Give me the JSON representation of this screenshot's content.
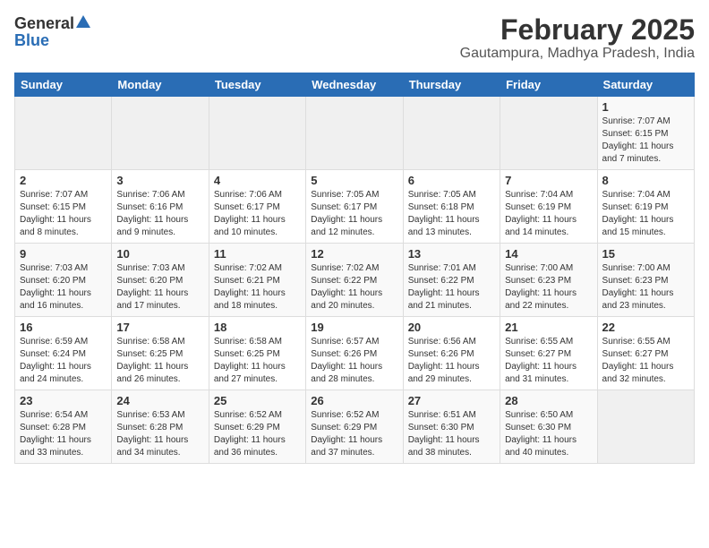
{
  "header": {
    "logo_general": "General",
    "logo_blue": "Blue",
    "title": "February 2025",
    "subtitle": "Gautampura, Madhya Pradesh, India"
  },
  "weekdays": [
    "Sunday",
    "Monday",
    "Tuesday",
    "Wednesday",
    "Thursday",
    "Friday",
    "Saturday"
  ],
  "weeks": [
    [
      {
        "day": "",
        "info": ""
      },
      {
        "day": "",
        "info": ""
      },
      {
        "day": "",
        "info": ""
      },
      {
        "day": "",
        "info": ""
      },
      {
        "day": "",
        "info": ""
      },
      {
        "day": "",
        "info": ""
      },
      {
        "day": "1",
        "info": "Sunrise: 7:07 AM\nSunset: 6:15 PM\nDaylight: 11 hours\nand 7 minutes."
      }
    ],
    [
      {
        "day": "2",
        "info": "Sunrise: 7:07 AM\nSunset: 6:15 PM\nDaylight: 11 hours\nand 8 minutes."
      },
      {
        "day": "3",
        "info": "Sunrise: 7:06 AM\nSunset: 6:16 PM\nDaylight: 11 hours\nand 9 minutes."
      },
      {
        "day": "4",
        "info": "Sunrise: 7:06 AM\nSunset: 6:17 PM\nDaylight: 11 hours\nand 10 minutes."
      },
      {
        "day": "5",
        "info": "Sunrise: 7:05 AM\nSunset: 6:17 PM\nDaylight: 11 hours\nand 12 minutes."
      },
      {
        "day": "6",
        "info": "Sunrise: 7:05 AM\nSunset: 6:18 PM\nDaylight: 11 hours\nand 13 minutes."
      },
      {
        "day": "7",
        "info": "Sunrise: 7:04 AM\nSunset: 6:19 PM\nDaylight: 11 hours\nand 14 minutes."
      },
      {
        "day": "8",
        "info": "Sunrise: 7:04 AM\nSunset: 6:19 PM\nDaylight: 11 hours\nand 15 minutes."
      }
    ],
    [
      {
        "day": "9",
        "info": "Sunrise: 7:03 AM\nSunset: 6:20 PM\nDaylight: 11 hours\nand 16 minutes."
      },
      {
        "day": "10",
        "info": "Sunrise: 7:03 AM\nSunset: 6:20 PM\nDaylight: 11 hours\nand 17 minutes."
      },
      {
        "day": "11",
        "info": "Sunrise: 7:02 AM\nSunset: 6:21 PM\nDaylight: 11 hours\nand 18 minutes."
      },
      {
        "day": "12",
        "info": "Sunrise: 7:02 AM\nSunset: 6:22 PM\nDaylight: 11 hours\nand 20 minutes."
      },
      {
        "day": "13",
        "info": "Sunrise: 7:01 AM\nSunset: 6:22 PM\nDaylight: 11 hours\nand 21 minutes."
      },
      {
        "day": "14",
        "info": "Sunrise: 7:00 AM\nSunset: 6:23 PM\nDaylight: 11 hours\nand 22 minutes."
      },
      {
        "day": "15",
        "info": "Sunrise: 7:00 AM\nSunset: 6:23 PM\nDaylight: 11 hours\nand 23 minutes."
      }
    ],
    [
      {
        "day": "16",
        "info": "Sunrise: 6:59 AM\nSunset: 6:24 PM\nDaylight: 11 hours\nand 24 minutes."
      },
      {
        "day": "17",
        "info": "Sunrise: 6:58 AM\nSunset: 6:25 PM\nDaylight: 11 hours\nand 26 minutes."
      },
      {
        "day": "18",
        "info": "Sunrise: 6:58 AM\nSunset: 6:25 PM\nDaylight: 11 hours\nand 27 minutes."
      },
      {
        "day": "19",
        "info": "Sunrise: 6:57 AM\nSunset: 6:26 PM\nDaylight: 11 hours\nand 28 minutes."
      },
      {
        "day": "20",
        "info": "Sunrise: 6:56 AM\nSunset: 6:26 PM\nDaylight: 11 hours\nand 29 minutes."
      },
      {
        "day": "21",
        "info": "Sunrise: 6:55 AM\nSunset: 6:27 PM\nDaylight: 11 hours\nand 31 minutes."
      },
      {
        "day": "22",
        "info": "Sunrise: 6:55 AM\nSunset: 6:27 PM\nDaylight: 11 hours\nand 32 minutes."
      }
    ],
    [
      {
        "day": "23",
        "info": "Sunrise: 6:54 AM\nSunset: 6:28 PM\nDaylight: 11 hours\nand 33 minutes."
      },
      {
        "day": "24",
        "info": "Sunrise: 6:53 AM\nSunset: 6:28 PM\nDaylight: 11 hours\nand 34 minutes."
      },
      {
        "day": "25",
        "info": "Sunrise: 6:52 AM\nSunset: 6:29 PM\nDaylight: 11 hours\nand 36 minutes."
      },
      {
        "day": "26",
        "info": "Sunrise: 6:52 AM\nSunset: 6:29 PM\nDaylight: 11 hours\nand 37 minutes."
      },
      {
        "day": "27",
        "info": "Sunrise: 6:51 AM\nSunset: 6:30 PM\nDaylight: 11 hours\nand 38 minutes."
      },
      {
        "day": "28",
        "info": "Sunrise: 6:50 AM\nSunset: 6:30 PM\nDaylight: 11 hours\nand 40 minutes."
      },
      {
        "day": "",
        "info": ""
      }
    ]
  ]
}
